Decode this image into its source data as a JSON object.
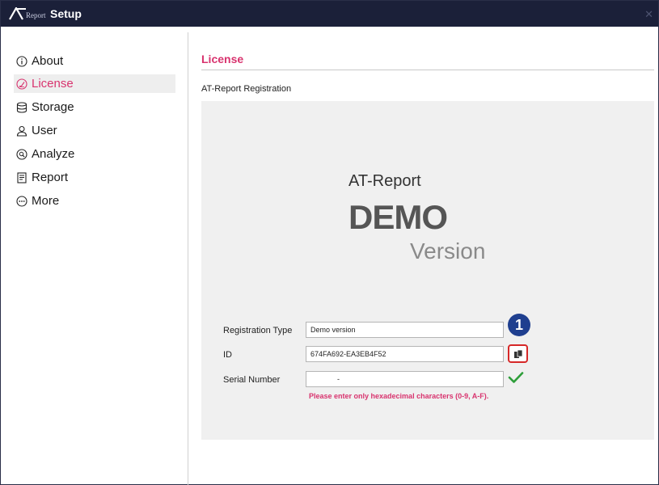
{
  "window": {
    "logo_sub": "Report",
    "title": "Setup"
  },
  "sidebar": {
    "items": [
      {
        "label": "About",
        "icon": "info-icon",
        "active": false
      },
      {
        "label": "License",
        "icon": "license-icon",
        "active": true
      },
      {
        "label": "Storage",
        "icon": "database-icon",
        "active": false
      },
      {
        "label": "User",
        "icon": "user-icon",
        "active": false
      },
      {
        "label": "Analyze",
        "icon": "analyze-icon",
        "active": false
      },
      {
        "label": "Report",
        "icon": "report-icon",
        "active": false
      },
      {
        "label": "More",
        "icon": "more-icon",
        "active": false
      }
    ]
  },
  "main": {
    "section_title": "License",
    "subtitle": "AT-Report Registration",
    "brand": {
      "product": "AT-Report",
      "edition": "DEMO",
      "suffix": "Version"
    },
    "form": {
      "registration_type_label": "Registration Type",
      "registration_type_value": "Demo version",
      "id_label": "ID",
      "id_value": "674FA692-EA3EB4F52",
      "serial_label": "Serial Number",
      "serial_value": "-",
      "error": "Please enter only hexadecimal characters (0-9, A-F)."
    },
    "callout_number": "1"
  },
  "colors": {
    "titlebar": "#1b2039",
    "accent": "#d8336e",
    "panel": "#f0f0f0",
    "callout": "#1f3f8f",
    "highlight": "#d62828",
    "check": "#2e9e3a"
  }
}
